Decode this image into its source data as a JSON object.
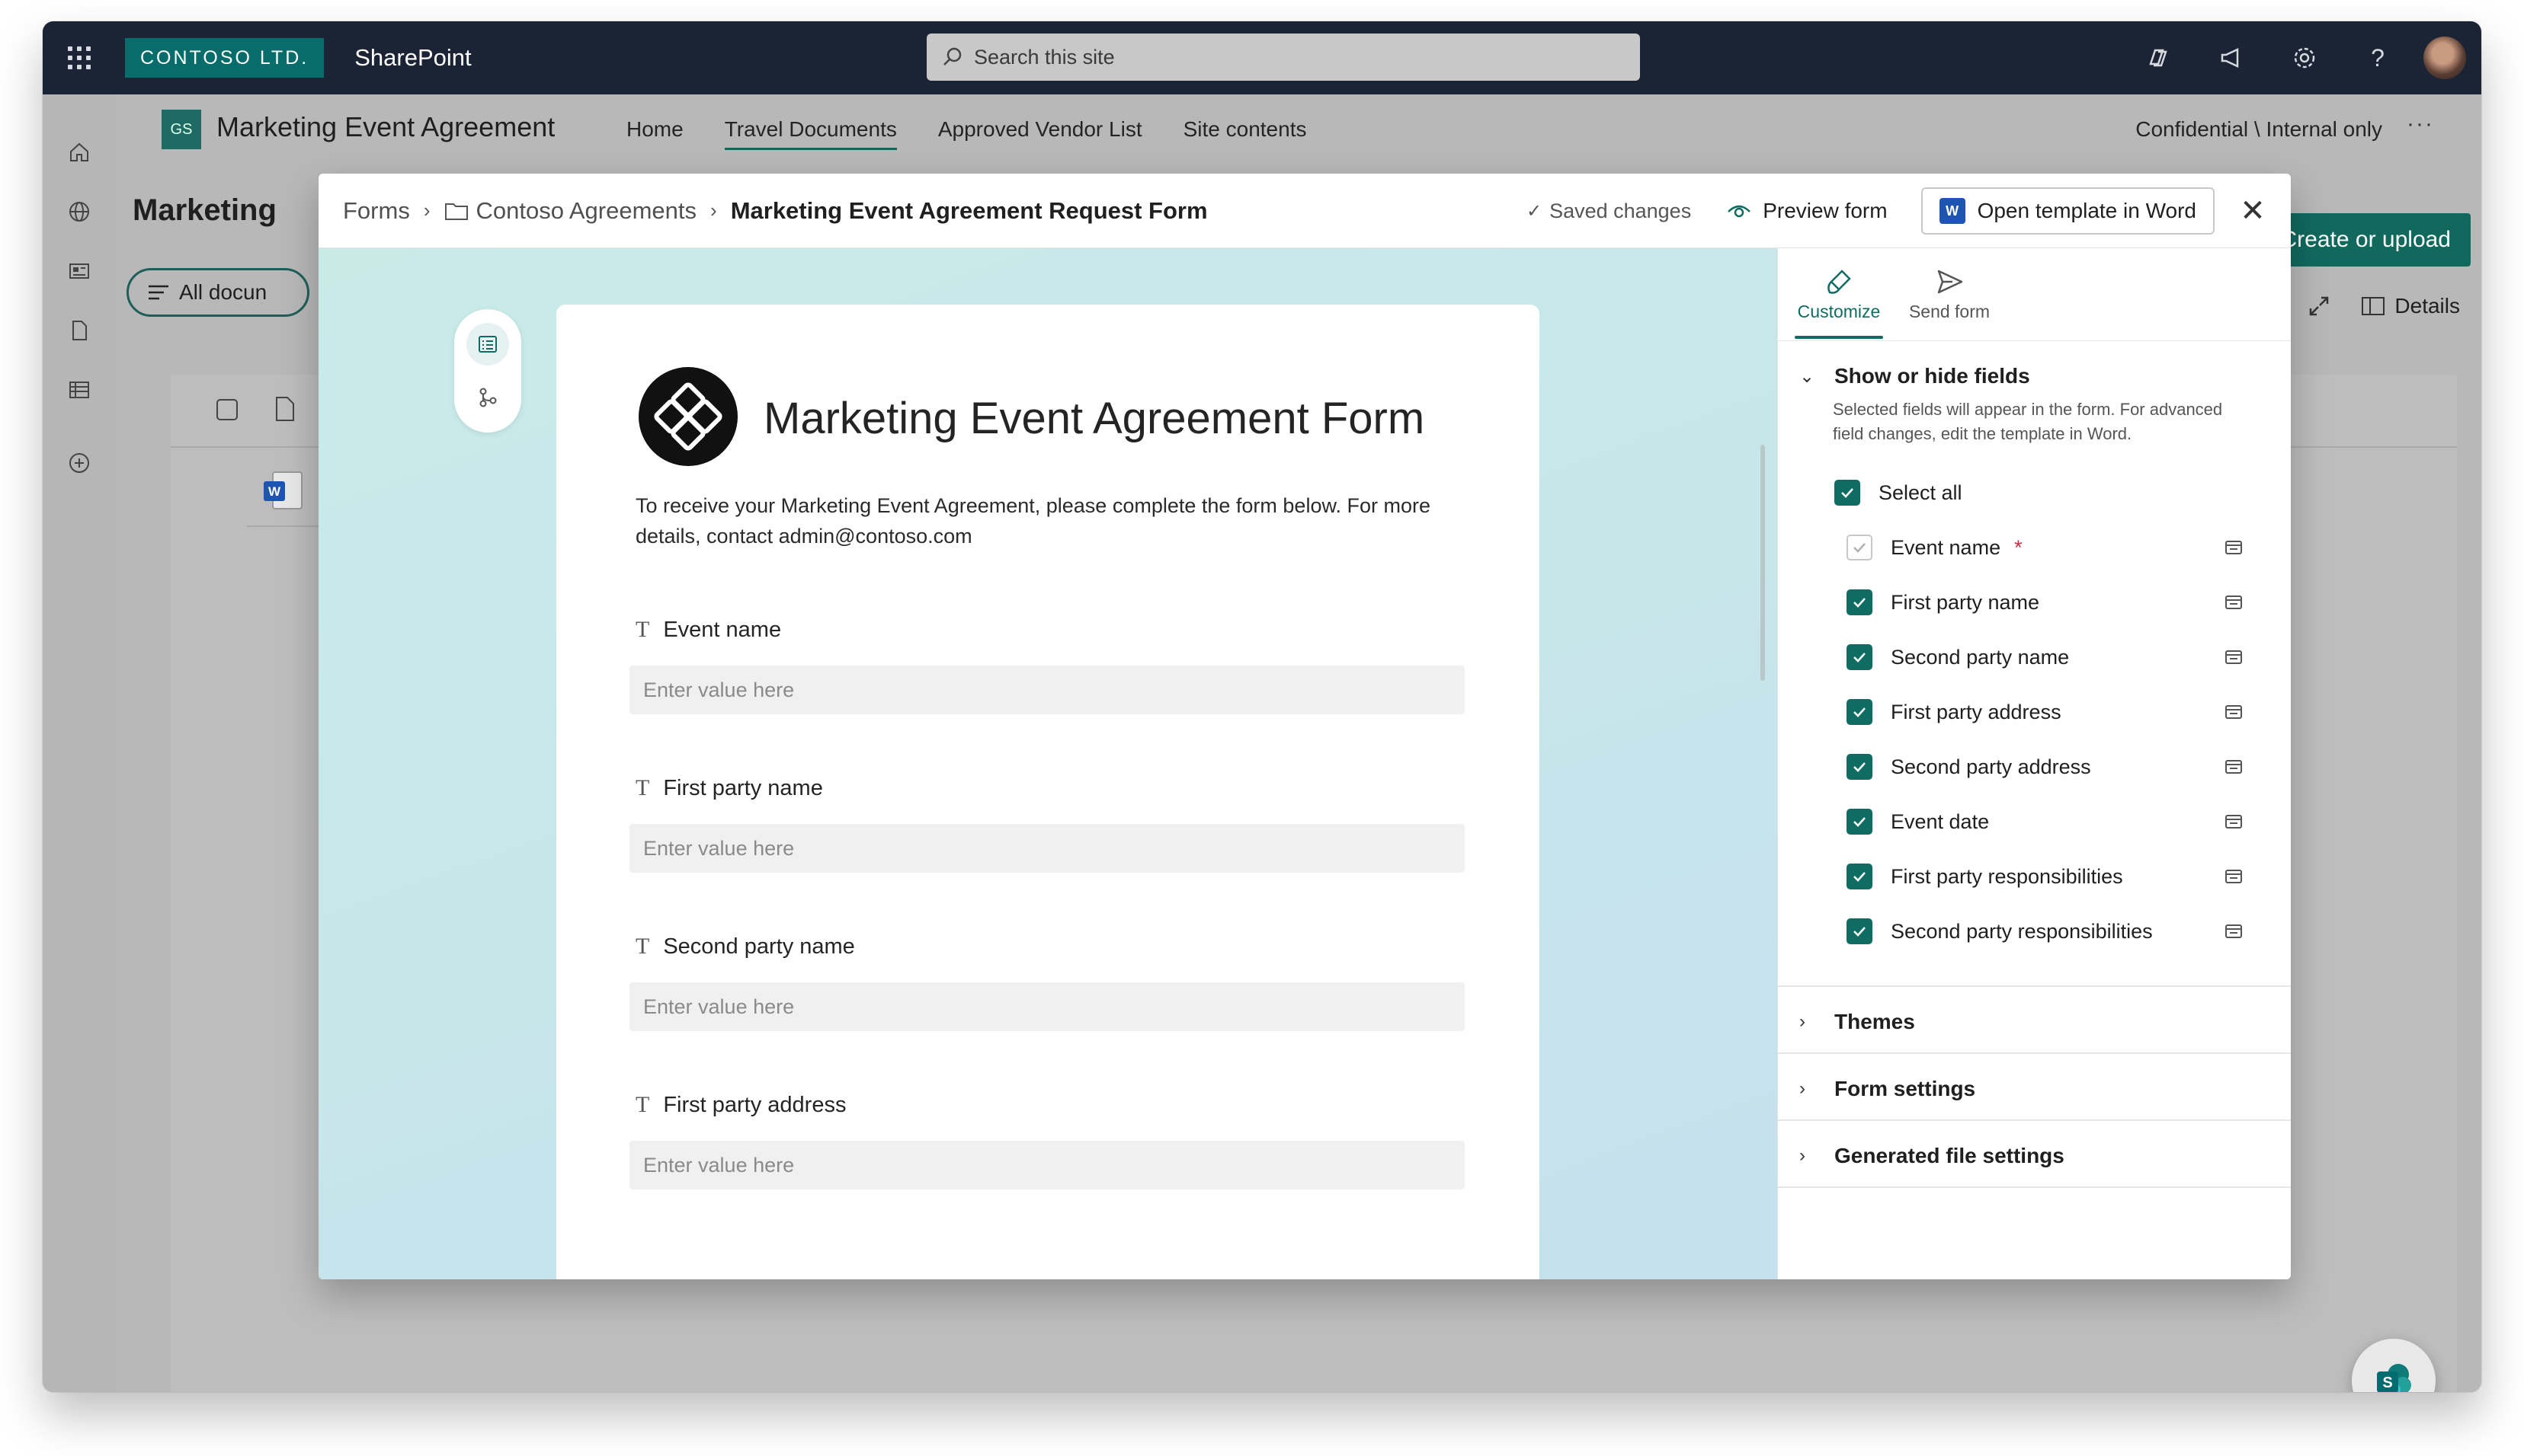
{
  "suite": {
    "brand": "CONTOSO LTD.",
    "app": "SharePoint",
    "search_placeholder": "Search this site"
  },
  "site": {
    "logo_text": "GS",
    "title": "Marketing Event Agreement",
    "nav": [
      "Home",
      "Travel Documents",
      "Approved Vendor List",
      "Site contents"
    ],
    "confidential": "Confidential \\ Internal only",
    "page_title": "Marketing",
    "view_label": "All docun",
    "create_label": "Create or upload",
    "details_label": "Details"
  },
  "modal": {
    "breadcrumbs": [
      "Forms",
      "Contoso Agreements",
      "Marketing Event Agreement Request Form"
    ],
    "saved": "Saved changes",
    "preview": "Preview form",
    "open_word": "Open template in Word",
    "word_icon": "W"
  },
  "form": {
    "title": "Marketing Event Agreement Form",
    "description": "To receive your Marketing Event Agreement, please complete the form below. For more details, contact admin@contoso.com",
    "field_placeholder": "Enter value here",
    "fields": [
      "Event name",
      "First party name",
      "Second party name",
      "First party address"
    ]
  },
  "panel": {
    "tabs": [
      "Customize",
      "Send form"
    ],
    "show_hide": {
      "title": "Show or hide fields",
      "description": "Selected fields will appear in the form. For advanced field changes, edit the template in Word.",
      "select_all": "Select all",
      "required_mark": "*",
      "items": [
        {
          "label": "Event name",
          "checked": true,
          "locked": true
        },
        {
          "label": "First party name",
          "checked": true
        },
        {
          "label": "Second party name",
          "checked": true
        },
        {
          "label": "First party address",
          "checked": true
        },
        {
          "label": "Second party address",
          "checked": true
        },
        {
          "label": "Event date",
          "checked": true
        },
        {
          "label": "First party responsibilities",
          "checked": true
        },
        {
          "label": "Second party responsibilities",
          "checked": true
        }
      ]
    },
    "sections": [
      "Themes",
      "Form settings",
      "Generated file settings"
    ]
  },
  "colors": {
    "accent": "#0f6c63",
    "suite_bar": "#1b2434",
    "brand_tile": "#076c6a"
  }
}
